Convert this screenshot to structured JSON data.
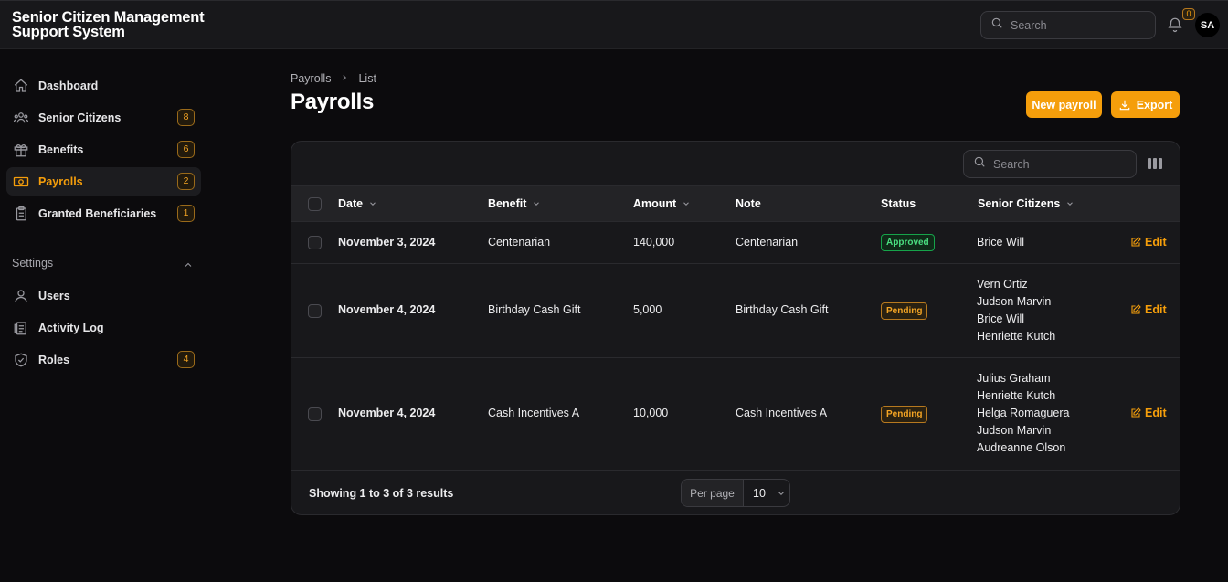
{
  "app": {
    "title": "Senior Citizen Management Support System"
  },
  "header": {
    "search_placeholder": "Search",
    "notification_count": "0",
    "avatar_initials": "SA"
  },
  "sidebar": {
    "items": [
      {
        "label": "Dashboard",
        "icon": "home-icon"
      },
      {
        "label": "Senior Citizens",
        "icon": "users-group-icon",
        "badge": "8"
      },
      {
        "label": "Benefits",
        "icon": "gift-icon",
        "badge": "6"
      },
      {
        "label": "Payrolls",
        "icon": "banknote-icon",
        "badge": "2",
        "active": true
      },
      {
        "label": "Granted Beneficiaries",
        "icon": "clipboard-icon",
        "badge": "1"
      }
    ],
    "settings_group": {
      "label": "Settings",
      "items": [
        {
          "label": "Users",
          "icon": "user-icon"
        },
        {
          "label": "Activity Log",
          "icon": "clipboard-list-icon"
        },
        {
          "label": "Roles",
          "icon": "shield-check-icon",
          "badge": "4"
        }
      ]
    }
  },
  "page": {
    "breadcrumb": [
      "Payrolls",
      "List"
    ],
    "title": "Payrolls",
    "new_button": "New payroll",
    "export_button": "Export",
    "table_search_placeholder": "Search"
  },
  "table": {
    "columns": [
      "Date",
      "Benefit",
      "Amount",
      "Note",
      "Status",
      "Senior Citizens"
    ],
    "rows": [
      {
        "date": "November 3, 2024",
        "benefit": "Centenarian",
        "amount": "140,000",
        "note": "Centenarian",
        "status": "Approved",
        "citizens": [
          "Brice Will"
        ],
        "action": "Edit"
      },
      {
        "date": "November 4, 2024",
        "benefit": "Birthday Cash Gift",
        "amount": "5,000",
        "note": "Birthday Cash Gift",
        "status": "Pending",
        "citizens": [
          "Vern Ortiz",
          "Judson Marvin",
          "Brice Will",
          "Henriette Kutch"
        ],
        "action": "Edit"
      },
      {
        "date": "November 4, 2024",
        "benefit": "Cash Incentives A",
        "amount": "10,000",
        "note": "Cash Incentives A",
        "status": "Pending",
        "citizens": [
          "Julius Graham",
          "Henriette Kutch",
          "Helga Romaguera",
          "Judson Marvin",
          "Audreanne Olson"
        ],
        "action": "Edit"
      }
    ],
    "footer": {
      "showing": "Showing 1 to 3 of 3 results",
      "per_page_label": "Per page",
      "per_page_value": "10"
    }
  },
  "colors": {
    "accent": "#f59e0b",
    "background": "#0c0b0d",
    "surface": "#18181b",
    "approved": "#4ade80"
  }
}
